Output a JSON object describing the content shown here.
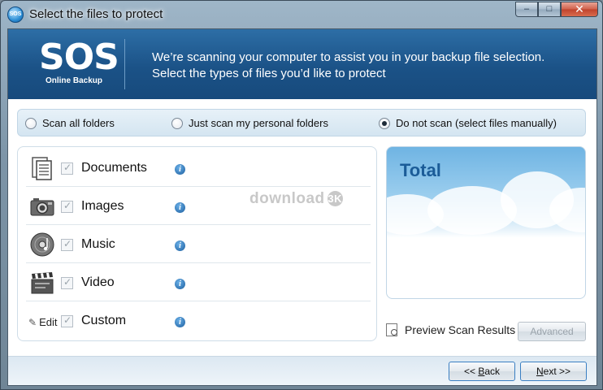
{
  "window": {
    "title": "Select the files to protect",
    "icon_text": "SOS",
    "controls": {
      "minimize": "–",
      "maximize": "□",
      "close": "✕"
    }
  },
  "header": {
    "logo_main": "SOS",
    "logo_sub": "Online Backup",
    "message": "We’re scanning your computer to assist you in your backup file selection. Select the types of files you’d like to protect"
  },
  "scan_options": {
    "options": [
      {
        "label": "Scan all folders",
        "selected": false
      },
      {
        "label": "Just scan my personal folders",
        "selected": false
      },
      {
        "label": "Do not scan (select files manually)",
        "selected": true
      }
    ]
  },
  "file_types": [
    {
      "label": "Documents",
      "icon": "documents-icon",
      "checked": true
    },
    {
      "label": "Images",
      "icon": "camera-icon",
      "checked": true
    },
    {
      "label": "Music",
      "icon": "music-disc-icon",
      "checked": true
    },
    {
      "label": "Video",
      "icon": "clapperboard-icon",
      "checked": true
    },
    {
      "label": "Custom",
      "icon": "edit-pencil-icon",
      "checked": true
    }
  ],
  "custom_edit_label": "Edit",
  "info_glyph": "i",
  "watermark": {
    "text": "download",
    "badge": "3K"
  },
  "total_panel": {
    "title": "Total"
  },
  "preview": {
    "label": "Preview Scan Results"
  },
  "buttons": {
    "advanced": "Advanced",
    "back_prefix": "<< ",
    "back_accel": "B",
    "back_rest": "ack",
    "next_accel": "N",
    "next_rest": "ext >>"
  },
  "colors": {
    "banner": "#1b5287",
    "accent_text": "#1b5c98",
    "scan_bar": "#d4e5f1"
  }
}
